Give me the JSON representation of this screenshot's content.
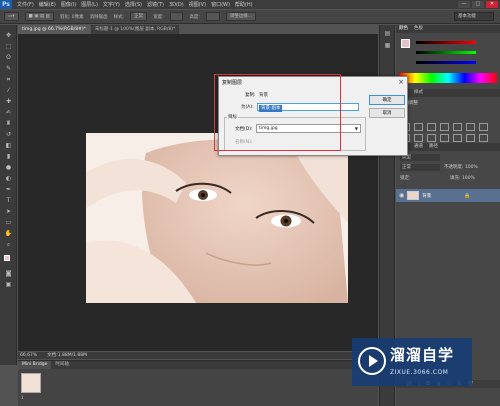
{
  "app": {
    "logo": "Ps"
  },
  "menu": [
    "文件(F)",
    "编辑(E)",
    "图像(I)",
    "图层(L)",
    "文字(Y)",
    "选择(S)",
    "滤镜(T)",
    "3D(D)",
    "视图(V)",
    "窗口(W)",
    "帮助(H)"
  ],
  "window_buttons": {
    "minimize": "—",
    "restore": "□",
    "close": "✕"
  },
  "options_bar": {
    "style_label": "样式:",
    "style_value": "正常",
    "width_label": "宽度:",
    "height_label": "高度:",
    "refine_edge": "调整边缘...",
    "antialias": "消除锯齿",
    "feather": "羽化: 0像素"
  },
  "workspace": "基本功能",
  "tabs": [
    {
      "label": "timg.jpg @ 66.7%(RGB/8#)*",
      "active": true
    },
    {
      "label": "未标题-1 @ 100%(图层 副本, RGB/8)*",
      "active": false
    }
  ],
  "status": {
    "zoom": "66.67%",
    "doc": "文档:1.88M/1.88M"
  },
  "bottom_panel": {
    "tabs": [
      "Mini Bridge",
      "时间轴"
    ],
    "thumb_label": "1"
  },
  "right_panel": {
    "top_tabs": [
      "颜色",
      "色板"
    ],
    "mid_tabs": [
      "调整",
      "样式"
    ],
    "mid_title": "添加调整",
    "layers_tabs": [
      "图层",
      "通道",
      "路径"
    ],
    "kind_label": "类型",
    "blend_mode": "正常",
    "opacity": "不透明度: 100%",
    "lock_label": "锁定:",
    "fill": "填充: 100%",
    "layer_name": "背景"
  },
  "dialog": {
    "title": "复制图层",
    "duplicate_label": "复制:",
    "duplicate_value": "背景",
    "as_label": "为(A):",
    "as_value": "背景 副本",
    "destination_label": "目标",
    "document_label": "文档(D):",
    "document_value": "timg.jpg",
    "name_label": "名称(N):",
    "ok": "确定",
    "cancel": "取消"
  },
  "watermark": {
    "title": "溜溜自学",
    "url": "ZIXUE.3066.COM"
  },
  "colors": {
    "accent": "#3478c6",
    "highlight": "#e0323a",
    "watermark": "#143c78"
  }
}
